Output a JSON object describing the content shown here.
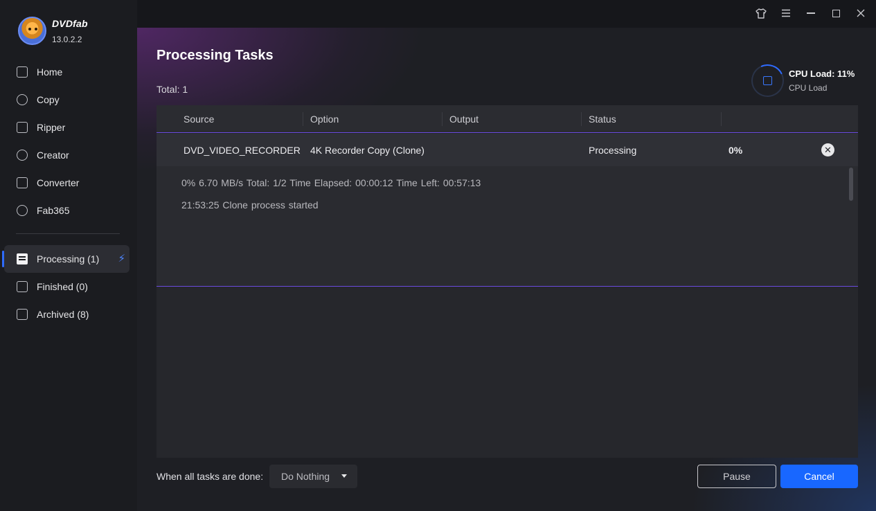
{
  "app": {
    "name": "DVDfab",
    "version": "13.0.2.2"
  },
  "sidebar": {
    "items": [
      {
        "label": "Home",
        "icon": "home-icon"
      },
      {
        "label": "Copy",
        "icon": "copy-icon"
      },
      {
        "label": "Ripper",
        "icon": "ripper-icon"
      },
      {
        "label": "Creator",
        "icon": "creator-icon"
      },
      {
        "label": "Converter",
        "icon": "converter-icon"
      },
      {
        "label": "Fab365",
        "icon": "fab365-icon"
      }
    ],
    "tasks": [
      {
        "label": "Processing (1)",
        "icon": "processing-icon",
        "active": true
      },
      {
        "label": "Finished (0)",
        "icon": "finished-icon"
      },
      {
        "label": "Archived (8)",
        "icon": "archived-icon"
      }
    ],
    "bolt_icon": "bolt-icon"
  },
  "titlebar": {
    "icons": [
      "shirt-icon",
      "menu-icon",
      "minimize-icon",
      "maximize-icon",
      "close-icon"
    ]
  },
  "main": {
    "title": "Processing Tasks",
    "total": "Total: 1",
    "cpu": {
      "title": "CPU Load: 11%",
      "subtitle": "CPU Load"
    },
    "table": {
      "columns": [
        "Source",
        "Option",
        "Output",
        "Status"
      ],
      "row": {
        "source": "DVD_VIDEO_RECORDER",
        "option": "4K Recorder Copy (Clone)",
        "output": "",
        "status": "Processing",
        "progress": "0%"
      }
    },
    "log": {
      "line1": "0%  6.70 MB/s   Total: 1/2  Time Elapsed: 00:00:12  Time Left: 00:57:13",
      "line2": "21:53:25  Clone process started"
    }
  },
  "footer": {
    "label": "When all tasks are done:",
    "select_value": "Do Nothing",
    "pause_label": "Pause",
    "cancel_label": "Cancel"
  },
  "colors": {
    "accent": "#1867ff",
    "divider": "#6a4be0",
    "bolt": "#4d86ff"
  }
}
